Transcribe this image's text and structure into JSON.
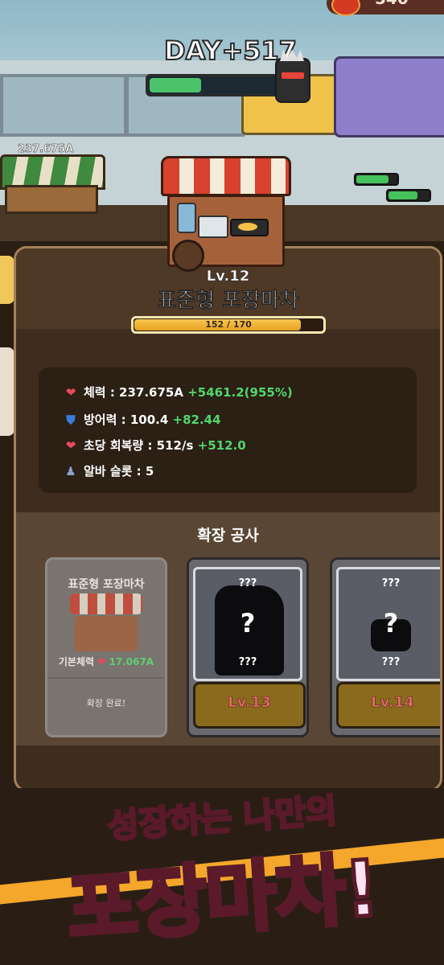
{
  "hud": {
    "coins": "540",
    "day": "DAY+517",
    "day_progress": 0.35
  },
  "scene": {
    "left_stall_hp": "237.675A"
  },
  "stall": {
    "level": "Lv.12",
    "name": "표준형 포장마차",
    "xp_text": "152 / 170",
    "xp_current": 152,
    "xp_max": 170
  },
  "stats": [
    {
      "icon": "heart-icon",
      "label": "체력 : 237.675A",
      "bonus": "+5461.2(955%)"
    },
    {
      "icon": "shield-icon",
      "label": "방어력 : 100.4",
      "bonus": "+82.44"
    },
    {
      "icon": "heart-plus-icon",
      "label": "초당 회복량 : 512/s",
      "bonus": "+512.0"
    },
    {
      "icon": "worker-icon",
      "label": "알바 슬롯 : 5",
      "bonus": ""
    }
  ],
  "expansion": {
    "title": "확장 공사",
    "cards": [
      {
        "name": "표준형 포장마차",
        "hp_label": "기본체력",
        "hp_value": "17.067A",
        "status": "확장 완료!"
      },
      {
        "top": "???",
        "mid": "?",
        "bottom": "???",
        "level": "Lv.13"
      },
      {
        "top": "???",
        "mid": "?",
        "bottom": "???",
        "level": "Lv.14"
      }
    ]
  },
  "slogan": {
    "line1": "성장하는 나만의",
    "line2": "포장마차!"
  },
  "colors": {
    "accent_green": "#4fd86a",
    "xp_yellow": "#f8c850",
    "panel_bg": "#3e2c1e"
  }
}
